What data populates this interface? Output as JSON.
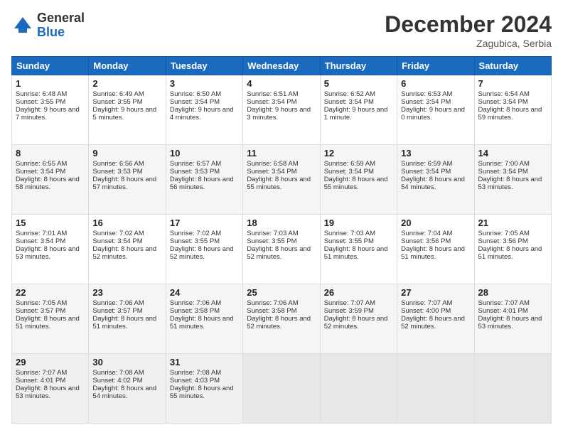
{
  "logo": {
    "general": "General",
    "blue": "Blue"
  },
  "title": "December 2024",
  "location": "Zagubica, Serbia",
  "days_header": [
    "Sunday",
    "Monday",
    "Tuesday",
    "Wednesday",
    "Thursday",
    "Friday",
    "Saturday"
  ],
  "weeks": [
    [
      {
        "day": "1",
        "sunrise": "6:48 AM",
        "sunset": "3:55 PM",
        "daylight": "9 hours and 7 minutes."
      },
      {
        "day": "2",
        "sunrise": "6:49 AM",
        "sunset": "3:55 PM",
        "daylight": "9 hours and 5 minutes."
      },
      {
        "day": "3",
        "sunrise": "6:50 AM",
        "sunset": "3:54 PM",
        "daylight": "9 hours and 4 minutes."
      },
      {
        "day": "4",
        "sunrise": "6:51 AM",
        "sunset": "3:54 PM",
        "daylight": "9 hours and 3 minutes."
      },
      {
        "day": "5",
        "sunrise": "6:52 AM",
        "sunset": "3:54 PM",
        "daylight": "9 hours and 1 minute."
      },
      {
        "day": "6",
        "sunrise": "6:53 AM",
        "sunset": "3:54 PM",
        "daylight": "9 hours and 0 minutes."
      },
      {
        "day": "7",
        "sunrise": "6:54 AM",
        "sunset": "3:54 PM",
        "daylight": "8 hours and 59 minutes."
      }
    ],
    [
      {
        "day": "8",
        "sunrise": "6:55 AM",
        "sunset": "3:54 PM",
        "daylight": "8 hours and 58 minutes."
      },
      {
        "day": "9",
        "sunrise": "6:56 AM",
        "sunset": "3:53 PM",
        "daylight": "8 hours and 57 minutes."
      },
      {
        "day": "10",
        "sunrise": "6:57 AM",
        "sunset": "3:53 PM",
        "daylight": "8 hours and 56 minutes."
      },
      {
        "day": "11",
        "sunrise": "6:58 AM",
        "sunset": "3:54 PM",
        "daylight": "8 hours and 55 minutes."
      },
      {
        "day": "12",
        "sunrise": "6:59 AM",
        "sunset": "3:54 PM",
        "daylight": "8 hours and 55 minutes."
      },
      {
        "day": "13",
        "sunrise": "6:59 AM",
        "sunset": "3:54 PM",
        "daylight": "8 hours and 54 minutes."
      },
      {
        "day": "14",
        "sunrise": "7:00 AM",
        "sunset": "3:54 PM",
        "daylight": "8 hours and 53 minutes."
      }
    ],
    [
      {
        "day": "15",
        "sunrise": "7:01 AM",
        "sunset": "3:54 PM",
        "daylight": "8 hours and 53 minutes."
      },
      {
        "day": "16",
        "sunrise": "7:02 AM",
        "sunset": "3:54 PM",
        "daylight": "8 hours and 52 minutes."
      },
      {
        "day": "17",
        "sunrise": "7:02 AM",
        "sunset": "3:55 PM",
        "daylight": "8 hours and 52 minutes."
      },
      {
        "day": "18",
        "sunrise": "7:03 AM",
        "sunset": "3:55 PM",
        "daylight": "8 hours and 52 minutes."
      },
      {
        "day": "19",
        "sunrise": "7:03 AM",
        "sunset": "3:55 PM",
        "daylight": "8 hours and 51 minutes."
      },
      {
        "day": "20",
        "sunrise": "7:04 AM",
        "sunset": "3:56 PM",
        "daylight": "8 hours and 51 minutes."
      },
      {
        "day": "21",
        "sunrise": "7:05 AM",
        "sunset": "3:56 PM",
        "daylight": "8 hours and 51 minutes."
      }
    ],
    [
      {
        "day": "22",
        "sunrise": "7:05 AM",
        "sunset": "3:57 PM",
        "daylight": "8 hours and 51 minutes."
      },
      {
        "day": "23",
        "sunrise": "7:06 AM",
        "sunset": "3:57 PM",
        "daylight": "8 hours and 51 minutes."
      },
      {
        "day": "24",
        "sunrise": "7:06 AM",
        "sunset": "3:58 PM",
        "daylight": "8 hours and 51 minutes."
      },
      {
        "day": "25",
        "sunrise": "7:06 AM",
        "sunset": "3:58 PM",
        "daylight": "8 hours and 52 minutes."
      },
      {
        "day": "26",
        "sunrise": "7:07 AM",
        "sunset": "3:59 PM",
        "daylight": "8 hours and 52 minutes."
      },
      {
        "day": "27",
        "sunrise": "7:07 AM",
        "sunset": "4:00 PM",
        "daylight": "8 hours and 52 minutes."
      },
      {
        "day": "28",
        "sunrise": "7:07 AM",
        "sunset": "4:01 PM",
        "daylight": "8 hours and 53 minutes."
      }
    ],
    [
      {
        "day": "29",
        "sunrise": "7:07 AM",
        "sunset": "4:01 PM",
        "daylight": "8 hours and 53 minutes."
      },
      {
        "day": "30",
        "sunrise": "7:08 AM",
        "sunset": "4:02 PM",
        "daylight": "8 hours and 54 minutes."
      },
      {
        "day": "31",
        "sunrise": "7:08 AM",
        "sunset": "4:03 PM",
        "daylight": "8 hours and 55 minutes."
      },
      null,
      null,
      null,
      null
    ]
  ],
  "labels": {
    "sunrise": "Sunrise: ",
    "sunset": "Sunset: ",
    "daylight": "Daylight: "
  }
}
